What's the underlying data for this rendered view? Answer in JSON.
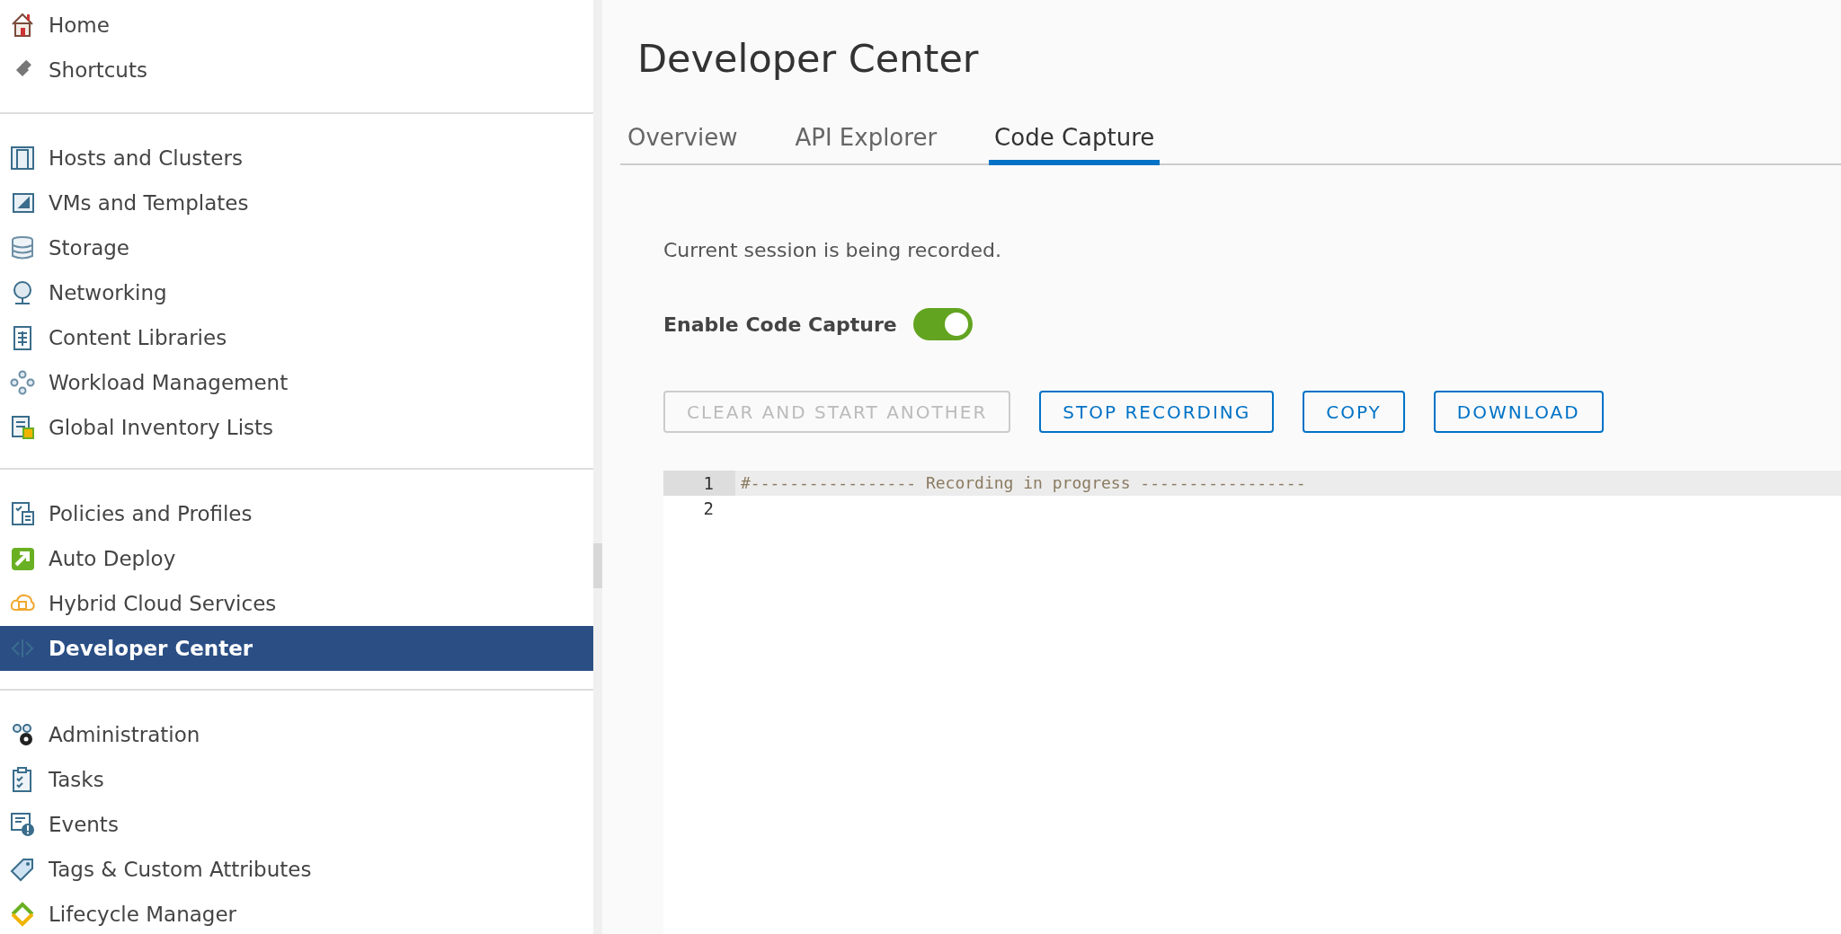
{
  "sidebar": {
    "groups": [
      {
        "items": [
          {
            "label": "Home",
            "selected": false
          },
          {
            "label": "Shortcuts",
            "selected": false
          }
        ]
      },
      {
        "items": [
          {
            "label": "Hosts and Clusters",
            "selected": false
          },
          {
            "label": "VMs and Templates",
            "selected": false
          },
          {
            "label": "Storage",
            "selected": false
          },
          {
            "label": "Networking",
            "selected": false
          },
          {
            "label": "Content Libraries",
            "selected": false
          },
          {
            "label": "Workload Management",
            "selected": false
          },
          {
            "label": "Global Inventory Lists",
            "selected": false
          }
        ]
      },
      {
        "items": [
          {
            "label": "Policies and Profiles",
            "selected": false
          },
          {
            "label": "Auto Deploy",
            "selected": false
          },
          {
            "label": "Hybrid Cloud Services",
            "selected": false
          },
          {
            "label": "Developer Center",
            "selected": true
          }
        ]
      },
      {
        "items": [
          {
            "label": "Administration",
            "selected": false
          },
          {
            "label": "Tasks",
            "selected": false
          },
          {
            "label": "Events",
            "selected": false
          },
          {
            "label": "Tags & Custom Attributes",
            "selected": false
          },
          {
            "label": "Lifecycle Manager",
            "selected": false
          }
        ]
      }
    ]
  },
  "page": {
    "title": "Developer Center",
    "tabs": [
      {
        "label": "Overview",
        "selected": false
      },
      {
        "label": "API Explorer",
        "selected": false
      },
      {
        "label": "Code Capture",
        "selected": true
      }
    ],
    "status": "Current session is being recorded.",
    "toggle": {
      "label": "Enable Code Capture",
      "on": true
    },
    "buttons": [
      {
        "label": "CLEAR AND START ANOTHER",
        "disabled": true
      },
      {
        "label": "STOP RECORDING",
        "disabled": false
      },
      {
        "label": "COPY",
        "disabled": false
      },
      {
        "label": "DOWNLOAD",
        "disabled": false
      }
    ],
    "editor": {
      "lines": [
        {
          "number": "1",
          "text": "#----------------- Recording in progress -----------------",
          "selected": true
        },
        {
          "number": "2",
          "selected": false
        }
      ]
    }
  }
}
